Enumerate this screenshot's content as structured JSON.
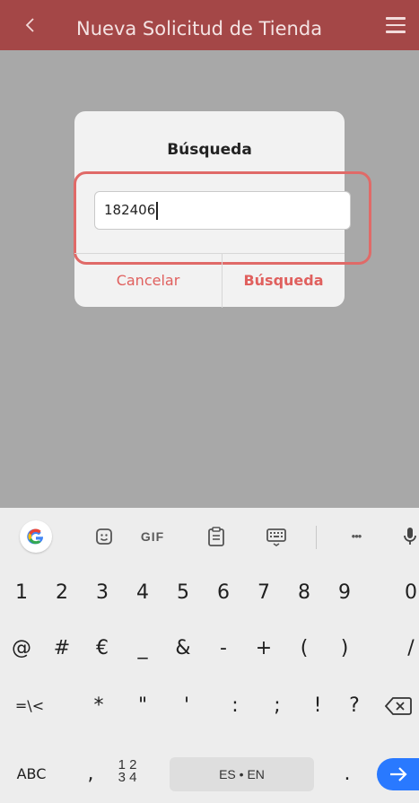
{
  "header": {
    "title": "Nueva Solicitud de Tienda",
    "back_icon": "chevron-left-icon",
    "menu_icon": "hamburger-menu-icon",
    "color": "#a44747"
  },
  "dialog": {
    "title": "Búsqueda",
    "input_value": "182406",
    "cancel_label": "Cancelar",
    "search_label": "Búsqueda",
    "accent_color": "#e0605e"
  },
  "keyboard": {
    "toolbar": [
      "google-icon",
      "sticker-icon",
      "GIF",
      "clipboard-icon",
      "keyboard-icon",
      "more-icon",
      "mic-icon"
    ],
    "gif_label": "GIF",
    "more_label": "•••",
    "row1": [
      "1",
      "2",
      "3",
      "4",
      "5",
      "6",
      "7",
      "8",
      "9",
      "0"
    ],
    "row2": [
      "@",
      "#",
      "€",
      "_",
      "&",
      "-",
      "+",
      "(",
      ")",
      "/"
    ],
    "row3": [
      "=\\<",
      "*",
      "\"",
      "'",
      ":",
      ";",
      "!",
      "?"
    ],
    "row4": {
      "abc": "ABC",
      "comma": ",",
      "frac_top": "1 2",
      "frac_bottom": "3 4",
      "space": "ES • EN",
      "period": "."
    }
  }
}
